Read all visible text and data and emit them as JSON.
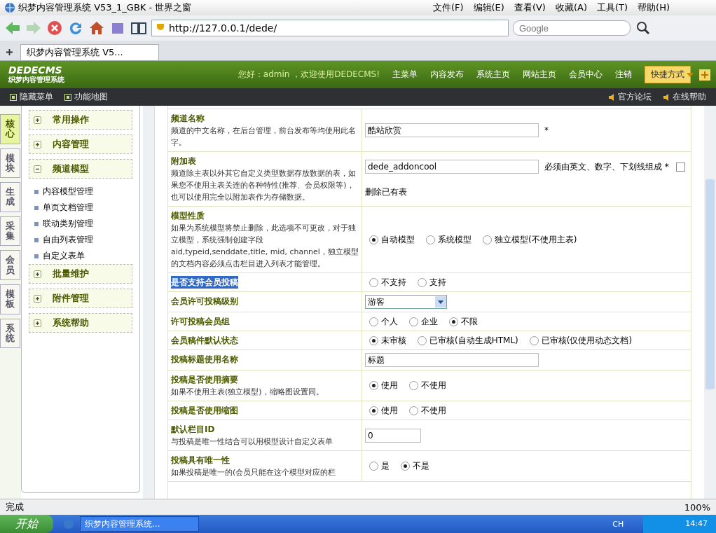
{
  "window": {
    "title": "织梦内容管理系统 V53_1_GBK - 世界之窗"
  },
  "menu": [
    "文件(F)",
    "编辑(E)",
    "查看(V)",
    "收藏(A)",
    "工具(T)",
    "帮助(H)"
  ],
  "address": "http://127.0.0.1/dede/",
  "search": {
    "placeholder": "Google"
  },
  "tabs": [
    {
      "label": "织梦内容管理系统 V5...",
      "selected": true
    }
  ],
  "header": {
    "logo": "DEDECMS",
    "logo_sub": "织梦内容管理系统",
    "greeting": "您好：admin ，欢迎使用DEDECMS!",
    "links": [
      "主菜单",
      "内容发布",
      "系统主页",
      "网站主页",
      "会员中心",
      "注销"
    ],
    "quick": "快捷方式"
  },
  "subbar": {
    "left": [
      "隐藏菜单",
      "功能地图"
    ],
    "right": [
      "官方论坛",
      "在线帮助"
    ]
  },
  "side_tabs": [
    {
      "label": "核心",
      "selected": true
    },
    {
      "label": "模块",
      "selected": false
    },
    {
      "label": "生成",
      "selected": false
    },
    {
      "label": "采集",
      "selected": false
    },
    {
      "label": "会员",
      "selected": false
    },
    {
      "label": "模板",
      "selected": false
    },
    {
      "label": "系统",
      "selected": false
    }
  ],
  "side_menu": [
    {
      "label": "常用操作",
      "expanded": false
    },
    {
      "label": "内容管理",
      "expanded": false
    },
    {
      "label": "频道模型",
      "expanded": true,
      "children": [
        "内容模型管理",
        "单页文档管理",
        "联动类别管理",
        "自由列表管理",
        "自定义表单"
      ]
    },
    {
      "label": "批量维护",
      "expanded": false
    },
    {
      "label": "附件管理",
      "expanded": false
    },
    {
      "label": "系统帮助",
      "expanded": false
    }
  ],
  "form": [
    {
      "kind": "text",
      "label": "频道名称",
      "highlighted": false,
      "description": "频道的中文名称，在后台管理，前台发布等均使用此名字。",
      "value": "酷站欣赏",
      "note": "*"
    },
    {
      "kind": "text",
      "label": "附加表",
      "highlighted": false,
      "description": "频道除主表以外其它自定义类型数据存放数据的表，如果您不使用主表关连的各种特性(推荐、会员权限等)，也可以使用完全以附加表作为存储数据。",
      "value": "dede_addoncool",
      "note": "必须由英文、数字、下划线组成 *",
      "checkbox": {
        "label": "删除已有表",
        "checked": false
      }
    },
    {
      "kind": "radio",
      "label": "模型性质",
      "highlighted": false,
      "description": "如果为系统模型将禁止删除，此选项不可更改，对于独立模型，系统强制创建字段aid,typeid,senddate,title, mid, channel，独立模型的文档内容必须点击栏目进入列表才能管理。",
      "options": [
        {
          "label": "自动模型",
          "selected": true
        },
        {
          "label": "系统模型",
          "selected": false
        },
        {
          "label": "独立模型(不使用主表)",
          "selected": false
        }
      ]
    },
    {
      "kind": "radio",
      "label": "是否支持会员投稿",
      "highlighted": true,
      "options": [
        {
          "label": "不支持",
          "selected": false
        },
        {
          "label": "支持",
          "selected": false
        }
      ]
    },
    {
      "kind": "select",
      "label": "会员许可投稿级别",
      "highlighted": false,
      "value": "游客"
    },
    {
      "kind": "radio",
      "label": "许可投稿会员组",
      "highlighted": false,
      "options": [
        {
          "label": "个人",
          "selected": false
        },
        {
          "label": "企业",
          "selected": false
        },
        {
          "label": "不限",
          "selected": true
        }
      ]
    },
    {
      "kind": "radio",
      "label": "会员稿件默认状态",
      "highlighted": false,
      "options": [
        {
          "label": "未审核",
          "selected": true
        },
        {
          "label": "已审核(自动生成HTML)",
          "selected": false
        },
        {
          "label": "已审核(仅使用动态文档)",
          "selected": false
        }
      ]
    },
    {
      "kind": "text",
      "label": "投稿标题使用名称",
      "highlighted": false,
      "value": "标题"
    },
    {
      "kind": "radio",
      "label": "投稿是否使用摘要",
      "highlighted": false,
      "description": "如果不使用主表(独立模型)，缩略图设置同。",
      "options": [
        {
          "label": "使用",
          "selected": true
        },
        {
          "label": "不使用",
          "selected": false
        }
      ]
    },
    {
      "kind": "radio",
      "label": "投稿是否使用缩图",
      "highlighted": false,
      "options": [
        {
          "label": "使用",
          "selected": true
        },
        {
          "label": "不使用",
          "selected": false
        }
      ]
    },
    {
      "kind": "shortfield",
      "label": "默认栏目ID",
      "highlighted": false,
      "description": "与投稿是唯一性结合可以用模型设计自定义表单",
      "value": "0"
    },
    {
      "kind": "radio",
      "label": "投稿具有唯一性",
      "highlighted": false,
      "description": "如果投稿是唯一的(会员只能在这个模型对应的栏",
      "options": [
        {
          "label": "是",
          "selected": false
        },
        {
          "label": "不是",
          "selected": true
        }
      ]
    }
  ],
  "status_bar": {
    "text": "完成",
    "zoom": "100%"
  },
  "taskbar": {
    "start": "开始",
    "task": "织梦内容管理系统...",
    "lang": "CH",
    "clock": "14:47"
  }
}
